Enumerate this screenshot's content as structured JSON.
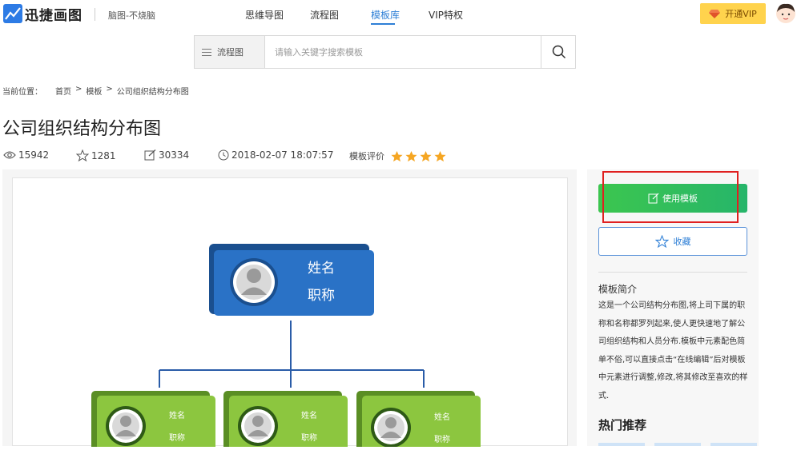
{
  "header": {
    "logo_text": "迅捷画图",
    "slogan": "脑图-不烧脑",
    "nav": [
      {
        "label": "思维导图",
        "active": false
      },
      {
        "label": "流程图",
        "active": false
      },
      {
        "label": "模板库",
        "active": true
      },
      {
        "label": "VIP特权",
        "active": false
      }
    ],
    "vip_button": "开通VIP",
    "colors": {
      "accent": "#2e7fd6",
      "vip": "#ffd34d"
    }
  },
  "search": {
    "category": "流程图",
    "placeholder": "请输入关键字搜索模板",
    "value": ""
  },
  "breadcrumb": {
    "prefix": "当前位置：",
    "items": [
      "首页",
      "模板",
      "公司组织结构分布图"
    ],
    "separator": ">"
  },
  "template": {
    "title": "公司组织结构分布图",
    "views": "15942",
    "stars": "1281",
    "edits": "30334",
    "date": "2018-02-07 18:07:57",
    "rating_label": "模板评价",
    "rating": 4
  },
  "preview": {
    "top_card": {
      "name": "姓名",
      "role": "职称",
      "color": "#2a72c6"
    },
    "child_cards": [
      {
        "name": "姓名",
        "role": "职称"
      },
      {
        "name": "姓名",
        "role": "职称"
      },
      {
        "name": "姓名",
        "role": "职称"
      }
    ],
    "child_color": "#8cc63f"
  },
  "sidebar": {
    "use_button": "使用模板",
    "fav_button": "收藏",
    "intro_title": "模板简介",
    "intro_body": "这是一个公司结构分布图,将上司下属的职称和名称都罗列起来,使人更快速地了解公司组织结构和人员分布.模板中元素配色简单不俗,可以直接点击“在线编辑”后对模板中元素进行调整,修改,将其修改至喜欢的样式.",
    "hot_title": "热门推荐"
  }
}
